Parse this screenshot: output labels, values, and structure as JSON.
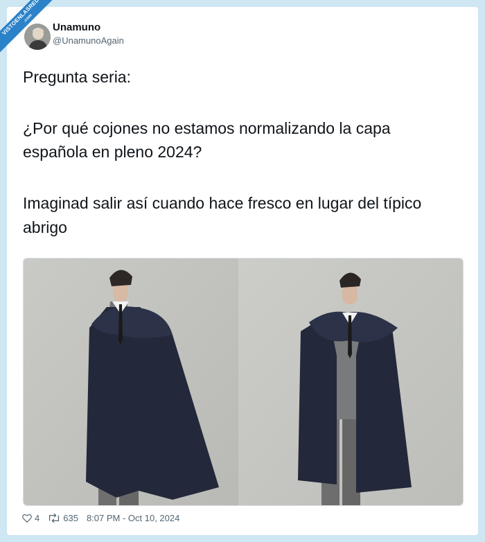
{
  "watermark": {
    "text": "VISTOENLASREDES",
    "suffix": ".com",
    "color": "#2b82c9"
  },
  "author": {
    "name": "Unamuno",
    "handle": "@UnamunoAgain"
  },
  "tweet": {
    "lines": [
      "Pregunta seria:",
      "¿Por qué cojones no estamos normalizando la capa",
      "española en pleno 2024?",
      "Imaginad salir así cuando hace fresco en lugar del típico",
      "abrigo"
    ]
  },
  "icons": {
    "like": "heart-icon",
    "retweet": "retweet-icon"
  },
  "stats": {
    "likes": "4",
    "retweets": "635",
    "timestamp": "8:07 PM - Oct 10, 2024"
  },
  "colors": {
    "background": "#cfe6f3",
    "text": "#0f1419",
    "muted": "#536471"
  }
}
